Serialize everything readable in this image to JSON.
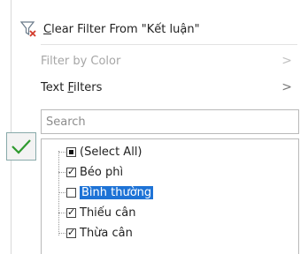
{
  "menu": {
    "clear_filter_prefix": "C",
    "clear_filter_rest": "lear Filter From \"Kết luận\"",
    "filter_by_color": "Filter by Color",
    "text_filters_prefix": "Text ",
    "text_filters_u": "F",
    "text_filters_rest": "ilters",
    "chevron": ">"
  },
  "search": {
    "placeholder": "Search"
  },
  "items": [
    {
      "label": "(Select All)",
      "state": "partial"
    },
    {
      "label": "Béo phì",
      "state": "checked"
    },
    {
      "label": "Bình thường",
      "state": "unchecked",
      "highlighted": true
    },
    {
      "label": "Thiếu cân",
      "state": "checked"
    },
    {
      "label": "Thừa cân",
      "state": "checked"
    }
  ],
  "colors": {
    "accent": "#1e73d6",
    "check_green": "#2e9a2e",
    "filter_red": "#d23a2a"
  }
}
